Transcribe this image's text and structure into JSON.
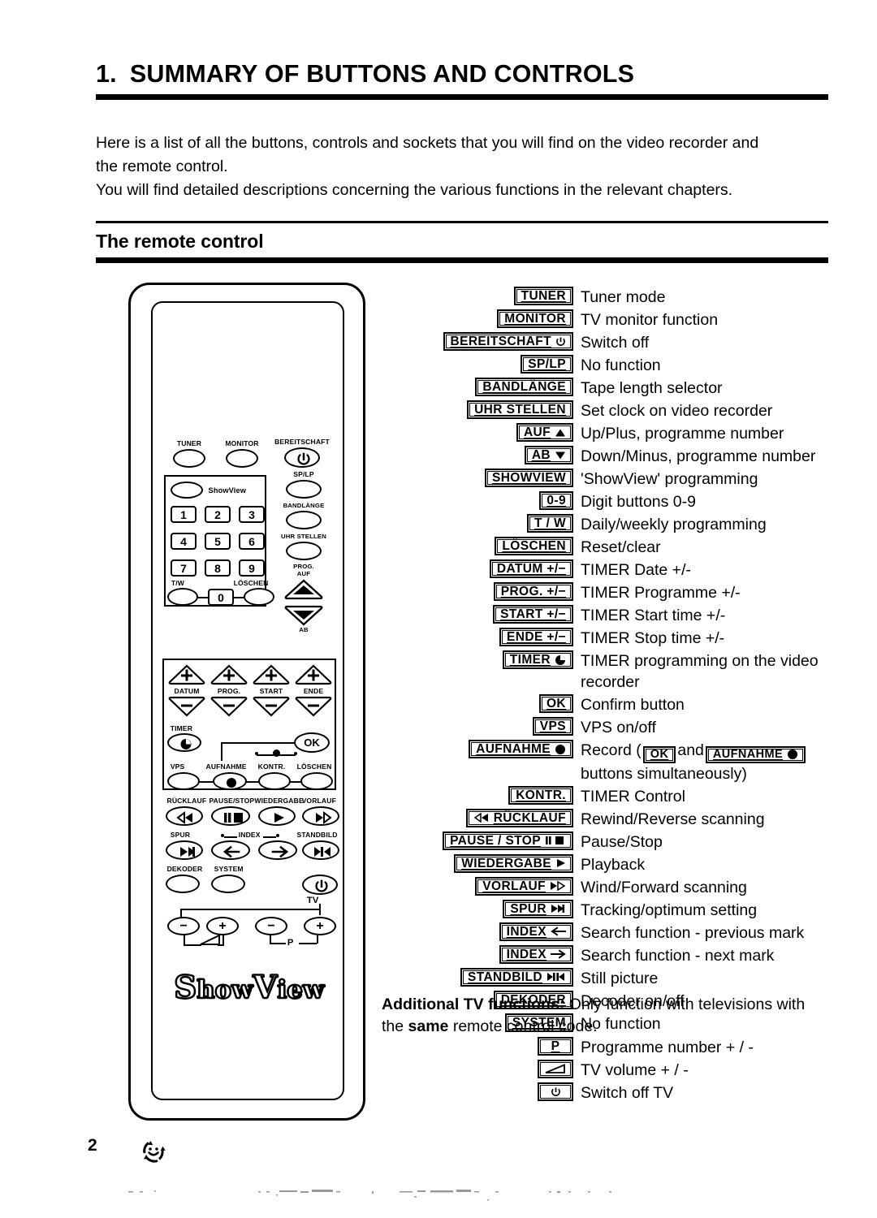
{
  "document": {
    "heading_number": "1.",
    "heading_title": "SUMMARY OF BUTTONS AND CONTROLS",
    "intro_line_1": "Here is a list of all the buttons, controls and sockets that you will find on the video recorder and",
    "intro_line_2": "the remote control.",
    "intro_line_3": "You will find detailed descriptions concerning the various functions in the relevant chapters.",
    "section_title": "The remote control",
    "page_number": "2",
    "footer_icon": "recycle-smiley-icon"
  },
  "remote": {
    "brand_logo": "ShowView",
    "brand_logo_caps": [
      "S",
      "how",
      "V",
      "iew"
    ],
    "showview_button_label": "ShowView",
    "top_buttons": [
      {
        "label": "TUNER"
      },
      {
        "label": "MONITOR"
      },
      {
        "label": "BEREITSCHAFT",
        "icon": "power-icon"
      }
    ],
    "right_column_buttons": [
      {
        "label": "SP/LP"
      },
      {
        "label": "BANDLÄNGE"
      },
      {
        "label": "UHR STELLEN"
      },
      {
        "label": "PROG.",
        "label2": "AUF",
        "icon": "triangle-up-icon"
      },
      {
        "label": "AB",
        "icon": "triangle-down-icon"
      }
    ],
    "keypad_digits": [
      "1",
      "2",
      "3",
      "4",
      "5",
      "6",
      "7",
      "8",
      "9",
      "0"
    ],
    "keypad_side_buttons": [
      {
        "label": "T/W"
      },
      {
        "label": "LÖSCHEN"
      }
    ],
    "timer_pad": [
      {
        "label": "DATUM",
        "plus": "+",
        "minus": "−"
      },
      {
        "label": "PROG.",
        "plus": "+",
        "minus": "−"
      },
      {
        "label": "START",
        "plus": "+",
        "minus": "−"
      },
      {
        "label": "ENDE",
        "plus": "+",
        "minus": "−"
      }
    ],
    "timer_row": [
      {
        "label": "TIMER",
        "icon": "timer-dot-icon"
      },
      {
        "label": "OK"
      }
    ],
    "function_row": [
      {
        "label": "VPS"
      },
      {
        "label": "AUFNAHME",
        "icon": "record-dot-icon"
      },
      {
        "label": "KONTR."
      },
      {
        "label": "LÖSCHEN"
      }
    ],
    "transport_row": [
      {
        "label": "RÜCKLAUF",
        "icon": "rewind-icon"
      },
      {
        "label": "PAUSE/STOP",
        "icon": "pause-stop-icon"
      },
      {
        "label": "WIEDERGABE",
        "icon": "play-icon"
      },
      {
        "label": "VORLAUF",
        "icon": "fast-forward-icon"
      }
    ],
    "index_row": [
      {
        "label": "SPUR",
        "icon": "tracking-icon"
      },
      {
        "label": "INDEX",
        "icon": "arrow-left-icon"
      },
      {
        "label": "",
        "icon": "arrow-right-icon"
      },
      {
        "label": "STANDBILD",
        "icon": "still-picture-icon"
      }
    ],
    "index_caption": "INDEX",
    "bottom_row": [
      {
        "label": "DEKODER"
      },
      {
        "label": "SYSTEM"
      },
      {
        "label": "",
        "icon": "tv-power-icon"
      }
    ],
    "tv_label": "TV",
    "p_label": "P",
    "volume_icon": "volume-wedge-icon",
    "tv_pad": [
      "−",
      "+",
      "−",
      "+"
    ]
  },
  "legend": {
    "rows": [
      {
        "key": "TUNER",
        "desc": "Tuner mode"
      },
      {
        "key": "MONITOR",
        "desc": "TV monitor function"
      },
      {
        "key": "BEREITSCHAFT",
        "icon": "power-icon",
        "desc": "Switch off"
      },
      {
        "key": "SP/LP",
        "desc": "No function"
      },
      {
        "key": "BANDLÄNGE",
        "desc": "Tape length selector"
      },
      {
        "key": "UHR  STELLEN",
        "desc": "Set clock on video recorder"
      },
      {
        "key": "AUF",
        "icon": "triangle-up-icon",
        "desc": "Up/Plus, programme number"
      },
      {
        "key": "AB",
        "icon": "triangle-down-icon",
        "desc": "Down/Minus, programme number"
      },
      {
        "key": "SHOWVIEW",
        "desc": "'ShowView' programming"
      },
      {
        "key": "0-9",
        "desc": "Digit buttons 0-9"
      },
      {
        "key": "T / W",
        "desc": "Daily/weekly programming"
      },
      {
        "key": "LÖSCHEN",
        "desc": "Reset/clear"
      },
      {
        "key": "DATUM  +/−",
        "desc": "TIMER Date +/-"
      },
      {
        "key": "PROG.  +/−",
        "desc": "TIMER Programme +/-"
      },
      {
        "key": "START  +/−",
        "desc": "TIMER Start time +/-"
      },
      {
        "key": "ENDE  +/−",
        "desc": "TIMER Stop time +/-"
      },
      {
        "key": "TIMER",
        "icon": "timer-dot-icon",
        "desc": "TIMER programming on the video recorder",
        "wrap": true
      },
      {
        "key": "OK",
        "desc": "Confirm button"
      },
      {
        "key": "VPS",
        "desc": "VPS on/off"
      },
      {
        "key": "AUFNAHME",
        "icon": "record-dot-icon",
        "desc": "record-compound",
        "wrap": true
      },
      {
        "key": "KONTR.",
        "desc": "TIMER Control"
      },
      {
        "key": "RÜCKLAUF",
        "icon": "rewind-icon",
        "icon_before": true,
        "desc": "Rewind/Reverse scanning"
      },
      {
        "key": "PAUSE / STOP",
        "icon": "pause-stop-icon",
        "desc": "Pause/Stop"
      },
      {
        "key": "WIEDERGABE",
        "icon": "play-icon",
        "desc": "Playback"
      },
      {
        "key": "VORLAUF",
        "icon": "fast-forward-icon",
        "desc": "Wind/Forward scanning"
      },
      {
        "key": "SPUR",
        "icon": "tracking-icon",
        "desc": "Tracking/optimum setting"
      },
      {
        "key": "INDEX",
        "icon": "arrow-left-icon",
        "desc": "Search function - previous mark"
      },
      {
        "key": "INDEX",
        "icon": "arrow-right-icon",
        "desc": "Search function - next mark"
      },
      {
        "key": "STANDBILD",
        "icon": "still-picture-icon",
        "desc": "Still picture"
      },
      {
        "key": "DEKODER",
        "desc": "Decoder on/off"
      },
      {
        "key": "SYSTEM",
        "desc": "No function"
      }
    ],
    "record_row": {
      "prefix": "Record (",
      "key_ok": "OK",
      "middle": "and",
      "key_rec": "AUFNAHME",
      "suffix": "buttons simultaneously)"
    },
    "additional": {
      "title": "Additional TV functions:",
      "text_1": "Only function with televisions with",
      "text_2_pre": "the ",
      "text_2_bold": "same",
      "text_2_post": " remote control code."
    },
    "tv_rows": [
      {
        "key": "P",
        "desc": "Programme number + / -"
      },
      {
        "key": "",
        "icon": "volume-wedge-icon",
        "desc": "TV volume + / -"
      },
      {
        "key": "",
        "icon": "power-icon",
        "desc": "Switch off TV"
      }
    ]
  }
}
